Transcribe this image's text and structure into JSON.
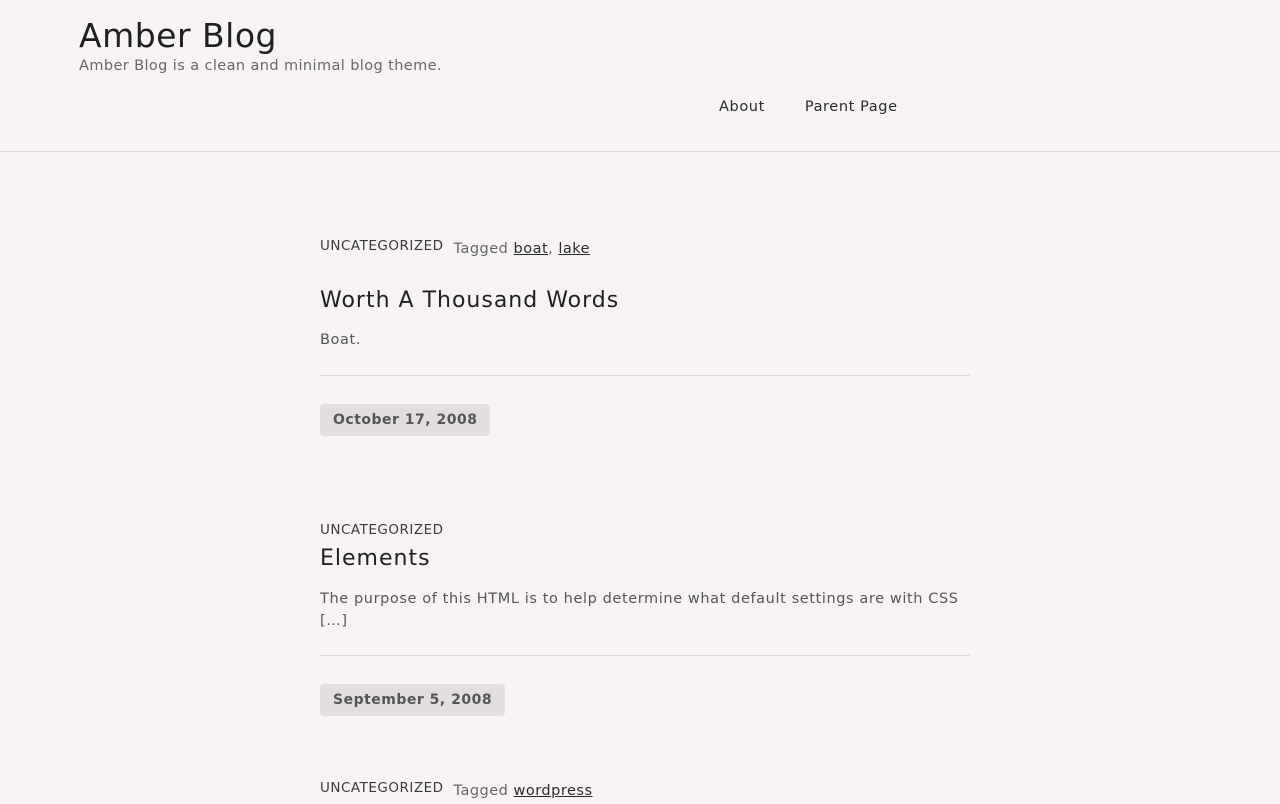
{
  "header": {
    "site_title": "Amber Blog",
    "site_description": "Amber Blog is a clean and minimal blog theme.",
    "nav": [
      {
        "label": "About"
      },
      {
        "label": "Parent Page"
      }
    ]
  },
  "posts": [
    {
      "category": "UNCATEGORIZED",
      "tagged_label": "Tagged",
      "tags": [
        "boat",
        "lake"
      ],
      "title": "Worth A Thousand Words",
      "excerpt": "Boat.",
      "date": "October 17, 2008"
    },
    {
      "category": "UNCATEGORIZED",
      "title": "Elements",
      "excerpt": "The purpose of this HTML is to help determine what default settings are with CSS […]",
      "date": "September 5, 2008"
    },
    {
      "category": "UNCATEGORIZED",
      "tagged_label": "Tagged",
      "tags": [
        "wordpress"
      ]
    }
  ]
}
